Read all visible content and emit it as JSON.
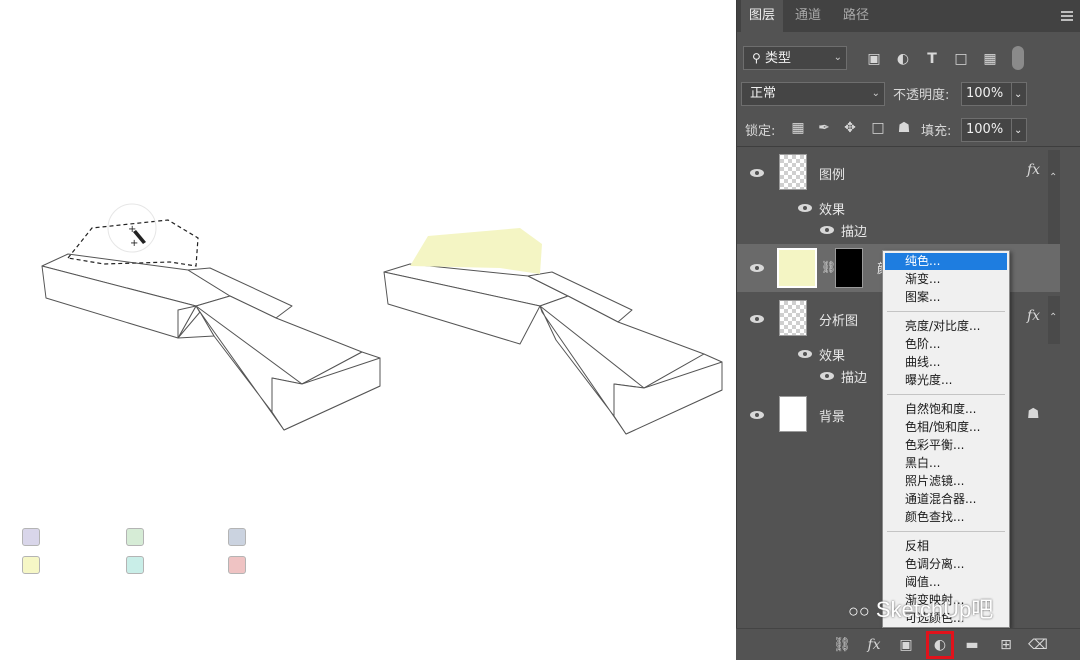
{
  "panel": {
    "tabs": [
      "图层",
      "通道",
      "路径"
    ],
    "filter": {
      "label": "类型"
    },
    "blend": {
      "mode": "正常",
      "opacity_label": "不透明度:",
      "opacity_value": "100%"
    },
    "lock": {
      "label": "锁定:",
      "fill_label": "填充:",
      "fill_value": "100%"
    }
  },
  "layers": {
    "legend": {
      "name": "图例",
      "fx": "fx",
      "effects": "效果",
      "stroke": "描边"
    },
    "fill_layer": {
      "name_fragment": "颜"
    },
    "analysis": {
      "name": "分析图",
      "fx": "fx",
      "effects": "效果",
      "stroke": "描边"
    },
    "background": {
      "name": "背景"
    }
  },
  "menu": {
    "items": [
      "纯色...",
      "渐变...",
      "图案...",
      "亮度/对比度...",
      "色阶...",
      "曲线...",
      "曝光度...",
      "自然饱和度...",
      "色相/饱和度...",
      "色彩平衡...",
      "黑白...",
      "照片滤镜...",
      "通道混合器...",
      "颜色查找...",
      "反相",
      "色调分离...",
      "阈值...",
      "渐变映射...",
      "可选颜色..."
    ]
  },
  "bottom_icons": [
    "link-icon",
    "fx-icon",
    "mask-icon",
    "adjustment-icon",
    "folder-icon",
    "new-layer-icon",
    "trash-icon"
  ],
  "watermark": "SketchUp吧",
  "colors": {
    "highlight_fill": "#f4f5c4",
    "menu_selected": "#1e7de0",
    "adjustment_button_outline": "#e0121b",
    "swatches": [
      "#d9d6ea",
      "#d6ecd6",
      "#cbd3e0",
      "#f6f7c6",
      "#c9eee8",
      "#efc3c3"
    ]
  }
}
